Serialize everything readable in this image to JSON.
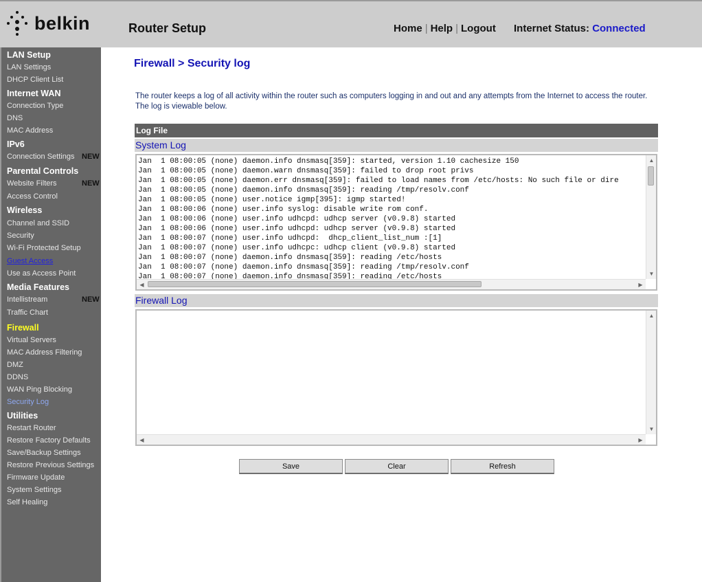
{
  "header": {
    "logo_text": "belkin",
    "title": "Router Setup",
    "nav": {
      "home": "Home",
      "help": "Help",
      "logout": "Logout",
      "separator": "|"
    },
    "status_label": "Internet Status:",
    "status_value": "Connected"
  },
  "sidebar": {
    "sections": [
      {
        "title": "LAN Setup",
        "items": [
          {
            "label": "LAN Settings"
          },
          {
            "label": "DHCP Client List"
          }
        ]
      },
      {
        "title": "Internet WAN",
        "items": [
          {
            "label": "Connection Type"
          },
          {
            "label": "DNS"
          },
          {
            "label": "MAC Address"
          }
        ]
      },
      {
        "title": "IPv6",
        "items": [
          {
            "label": "Connection Settings",
            "badge": "NEW"
          }
        ]
      },
      {
        "title": "Parental Controls",
        "items": [
          {
            "label": "Website Filters",
            "badge": "NEW"
          },
          {
            "label": "Access Control"
          }
        ]
      },
      {
        "title": "Wireless",
        "items": [
          {
            "label": "Channel and SSID"
          },
          {
            "label": "Security"
          },
          {
            "label": "Wi-Fi Protected Setup"
          },
          {
            "label": "Guest Access"
          },
          {
            "label": "Use as Access Point"
          }
        ]
      },
      {
        "title": "Media Features",
        "items": [
          {
            "label": "Intellistream",
            "badge": "NEW"
          },
          {
            "label": "Traffic Chart"
          }
        ]
      },
      {
        "title": "Firewall",
        "items": [
          {
            "label": "Virtual Servers"
          },
          {
            "label": "MAC Address Filtering"
          },
          {
            "label": "DMZ"
          },
          {
            "label": "DDNS"
          },
          {
            "label": "WAN Ping Blocking"
          },
          {
            "label": "Security Log"
          }
        ]
      },
      {
        "title": "Utilities",
        "items": [
          {
            "label": "Restart Router"
          },
          {
            "label": "Restore Factory Defaults"
          },
          {
            "label": "Save/Backup Settings"
          },
          {
            "label": "Restore Previous Settings"
          },
          {
            "label": "Firmware Update"
          },
          {
            "label": "System Settings"
          },
          {
            "label": "Self Healing"
          }
        ]
      }
    ]
  },
  "main": {
    "page_title": "Firewall > Security log",
    "intro": "The router keeps a log of all activity within the router such as computers logging in and out and any attempts from the Internet to access the router. The log is viewable below.",
    "logfile_header": "Log File",
    "system_log": {
      "label": "System Log",
      "lines": [
        "Jan  1 08:00:05 (none) daemon.info dnsmasq[359]: started, version 1.10 cachesize 150",
        "Jan  1 08:00:05 (none) daemon.warn dnsmasq[359]: failed to drop root privs",
        "Jan  1 08:00:05 (none) daemon.err dnsmasq[359]: failed to load names from /etc/hosts: No such file or dire",
        "Jan  1 08:00:05 (none) daemon.info dnsmasq[359]: reading /tmp/resolv.conf",
        "Jan  1 08:00:05 (none) user.notice igmp[395]: igmp started!",
        "Jan  1 08:00:06 (none) user.info syslog: disable write rom conf.",
        "Jan  1 08:00:06 (none) user.info udhcpd: udhcp server (v0.9.8) started",
        "Jan  1 08:00:06 (none) user.info udhcpd: udhcp server (v0.9.8) started",
        "Jan  1 08:00:07 (none) user.info udhcpd:  dhcp_client_list_num :[1]",
        "Jan  1 08:00:07 (none) user.info udhcpc: udhcp client (v0.9.8) started",
        "Jan  1 08:00:07 (none) daemon.info dnsmasq[359]: reading /etc/hosts",
        "Jan  1 08:00:07 (none) daemon.info dnsmasq[359]: reading /tmp/resolv.conf",
        "Jan  1 08:00:07 (none) daemon.info dnsmasq[359]: reading /etc/hosts"
      ]
    },
    "firewall_log": {
      "label": "Firewall Log",
      "lines": []
    },
    "buttons": {
      "save": "Save",
      "clear": "Clear",
      "refresh": "Refresh"
    }
  }
}
